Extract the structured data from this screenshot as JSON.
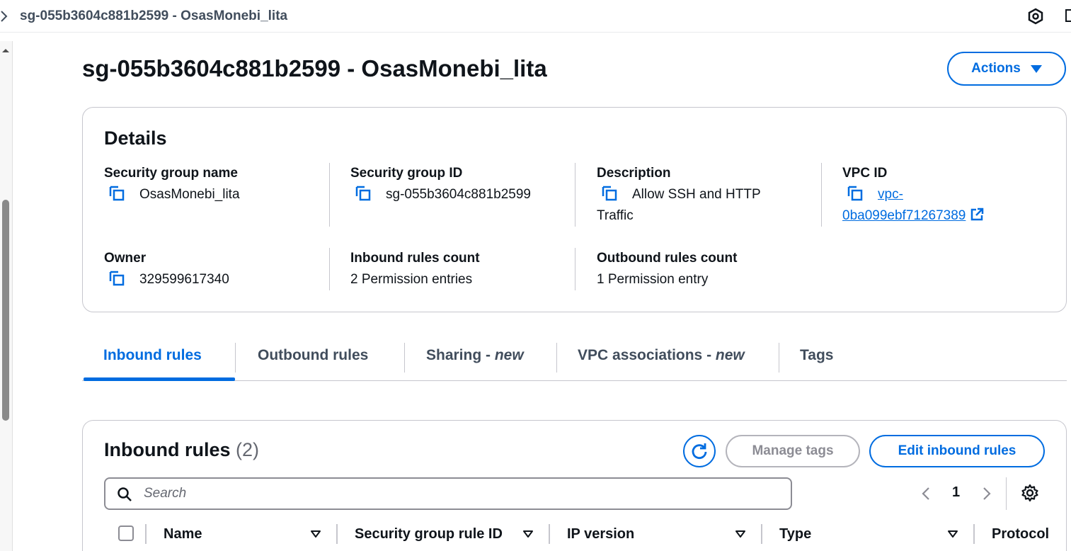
{
  "topbar": {
    "breadcrumb": "sg-055b3604c881b2599 - OsasMonebi_lita"
  },
  "header": {
    "title": "sg-055b3604c881b2599 - OsasMonebi_lita",
    "actions_label": "Actions"
  },
  "details": {
    "heading": "Details",
    "fields": {
      "sg_name": {
        "label": "Security group name",
        "value": "OsasMonebi_lita"
      },
      "sg_id": {
        "label": "Security group ID",
        "value": "sg-055b3604c881b2599"
      },
      "description": {
        "label": "Description",
        "value_line1": "Allow SSH and HTTP",
        "value_line2": "Traffic"
      },
      "vpc_id": {
        "label": "VPC ID",
        "value_line1": "vpc-",
        "value_line2": "0ba099ebf71267389"
      },
      "owner": {
        "label": "Owner",
        "value": "329599617340"
      },
      "inbound_count": {
        "label": "Inbound rules count",
        "value": "2 Permission entries"
      },
      "outbound_count": {
        "label": "Outbound rules count",
        "value": "1 Permission entry"
      }
    }
  },
  "tabs": [
    {
      "label": "Inbound rules",
      "suffix": "",
      "active": true
    },
    {
      "label": "Outbound rules",
      "suffix": "",
      "active": false
    },
    {
      "label": "Sharing - ",
      "suffix": "new",
      "active": false
    },
    {
      "label": "VPC associations - ",
      "suffix": "new",
      "active": false
    },
    {
      "label": "Tags",
      "suffix": "",
      "active": false
    }
  ],
  "rules": {
    "heading": "Inbound rules",
    "count": "(2)",
    "manage_tags_label": "Manage tags",
    "edit_label": "Edit inbound rules",
    "search_placeholder": "Search",
    "page": "1",
    "columns": [
      "Name",
      "Security group rule ID",
      "IP version",
      "Type",
      "Protocol"
    ]
  },
  "colors": {
    "accent": "#006ce0",
    "text": "#0f141a",
    "border": "#c6c6cd"
  }
}
